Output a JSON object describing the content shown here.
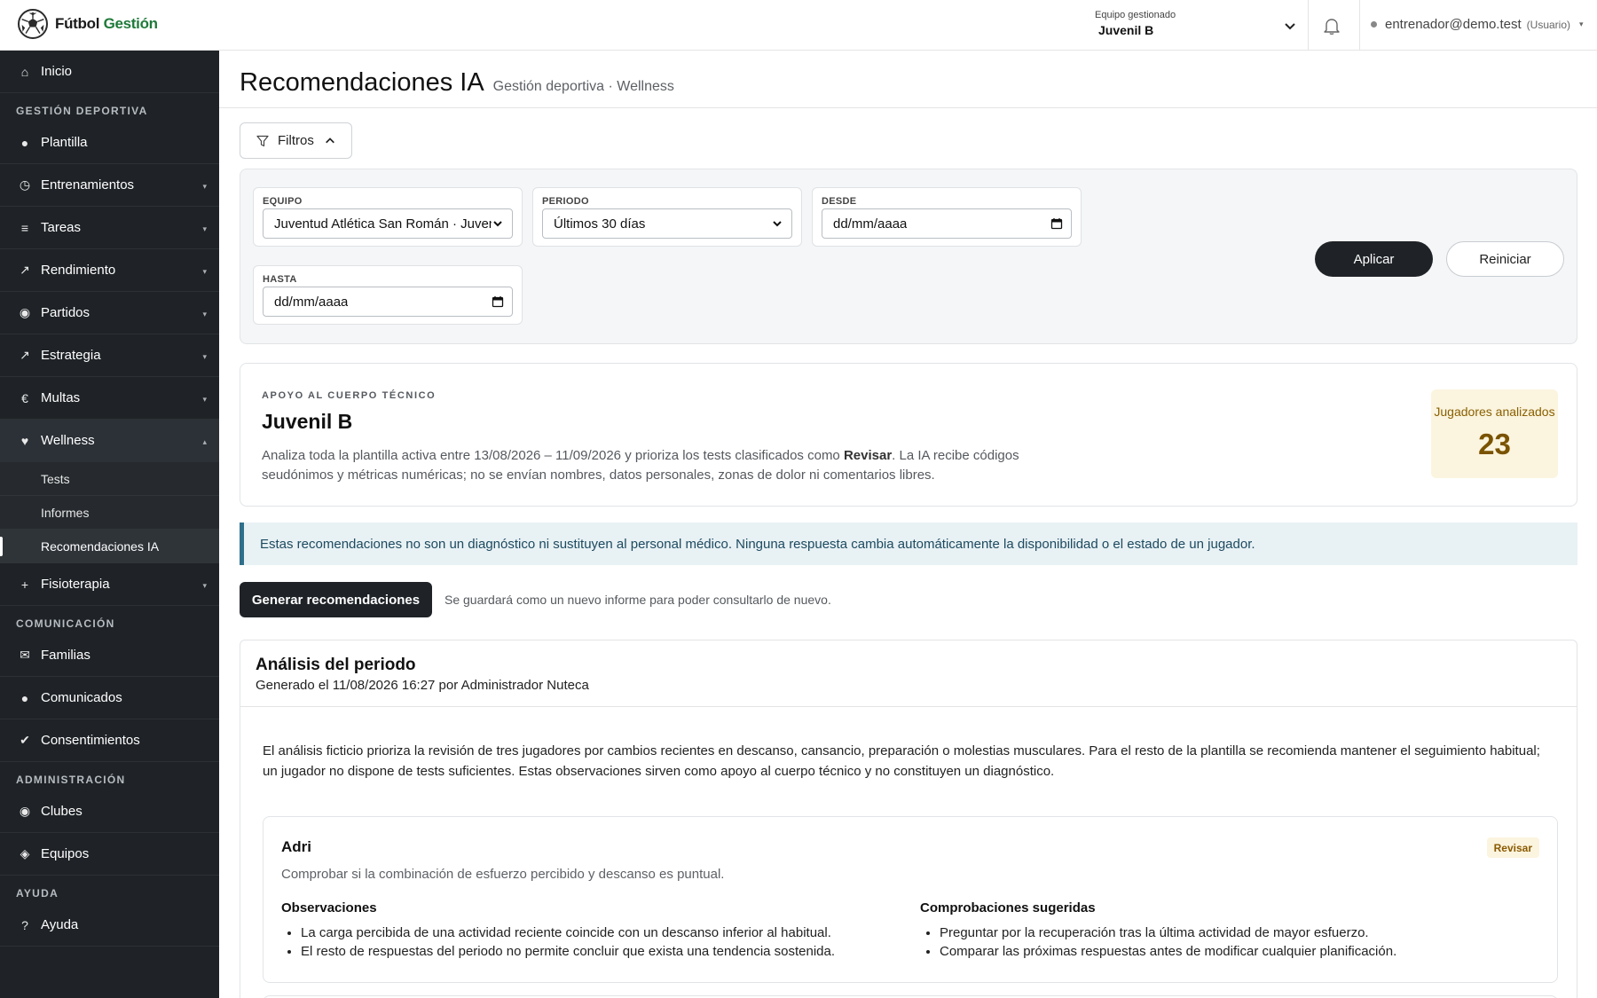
{
  "app": {
    "brand_part1": "Fútbol",
    "brand_part2": "Gestión"
  },
  "topbar": {
    "team_label": "Equipo gestionado",
    "team_value": "Juvenil B",
    "user_email": "entrenador@demo.test",
    "user_role": "(Usuario)"
  },
  "sidebar": {
    "home": "Inicio",
    "sections": {
      "deportiva": "GESTIÓN DEPORTIVA",
      "comunicacion": "COMUNICACIÓN",
      "administracion": "ADMINISTRACIÓN",
      "ayuda": "AYUDA"
    },
    "items": {
      "plantilla": "Plantilla",
      "entrenamientos": "Entrenamientos",
      "tareas": "Tareas",
      "rendimiento": "Rendimiento",
      "partidos": "Partidos",
      "estrategia": "Estrategia",
      "multas": "Multas",
      "wellness": "Wellness",
      "fisioterapia": "Fisioterapia",
      "familias": "Familias",
      "comunicados": "Comunicados",
      "consentimientos": "Consentimientos",
      "clubes": "Clubes",
      "equipos": "Equipos",
      "ayuda": "Ayuda"
    },
    "wellness_sub": {
      "tests": "Tests",
      "informes": "Informes",
      "recomendaciones": "Recomendaciones IA"
    }
  },
  "page": {
    "title": "Recomendaciones IA",
    "subtitle": "Gestión deportiva · Wellness"
  },
  "filters": {
    "toggle_label": "Filtros",
    "equipo_label": "EQUIPO",
    "equipo_value": "Juventud Atlética San Román · Juvenil B",
    "periodo_label": "PERIODO",
    "periodo_value": "Últimos 30 días",
    "desde_label": "DESDE",
    "desde_value": "dd/mm/aaaa",
    "hasta_label": "HASTA",
    "hasta_value": "dd/mm/aaaa",
    "apply_label": "Aplicar",
    "reset_label": "Reiniciar"
  },
  "support": {
    "eyebrow": "APOYO AL CUERPO TÉCNICO",
    "team": "Juvenil B",
    "desc_part1": "Analiza toda la plantilla activa entre 13/08/2026 – 11/09/2026 y prioriza los tests clasificados como ",
    "desc_bold": "Revisar",
    "desc_part2": ". La IA recibe códigos seudónimos y métricas numéricas; no se envían nombres, datos personales, zonas de dolor ni comentarios libres.",
    "stat_label": "Jugadores analizados",
    "stat_value": "23"
  },
  "notice": "Estas recomendaciones no son un diagnóstico ni sustituyen al personal médico. Ninguna respuesta cambia automáticamente la disponibilidad o el estado de un jugador.",
  "generate": {
    "button_label": "Generar recomendaciones",
    "hint": "Se guardará como un nuevo informe para poder consultarlo de nuevo."
  },
  "analysis": {
    "title": "Análisis del periodo",
    "meta": "Generado el 11/08/2026 16:27 por Administrador Nuteca",
    "summary": "El análisis ficticio prioriza la revisión de tres jugadores por cambios recientes en descanso, cansancio, preparación o molestias musculares. Para el resto de la plantilla se recomienda mantener el seguimiento habitual; un jugador no dispone de tests suficientes. Estas observaciones sirven como apoyo al cuerpo técnico y no constituyen un diagnóstico.",
    "players": [
      {
        "name": "Adri",
        "badge": "Revisar",
        "note": "Comprobar si la combinación de esfuerzo percibido y descanso es puntual.",
        "observations_title": "Observaciones",
        "observations": [
          "La carga percibida de una actividad reciente coincide con un descanso inferior al habitual.",
          "El resto de respuestas del periodo no permite concluir que exista una tendencia sostenida."
        ],
        "checks_title": "Comprobaciones sugeridas",
        "checks": [
          "Preguntar por la recuperación tras la última actividad de mayor esfuerzo.",
          "Comparar las próximas respuestas antes de modificar cualquier planificación."
        ]
      }
    ]
  }
}
